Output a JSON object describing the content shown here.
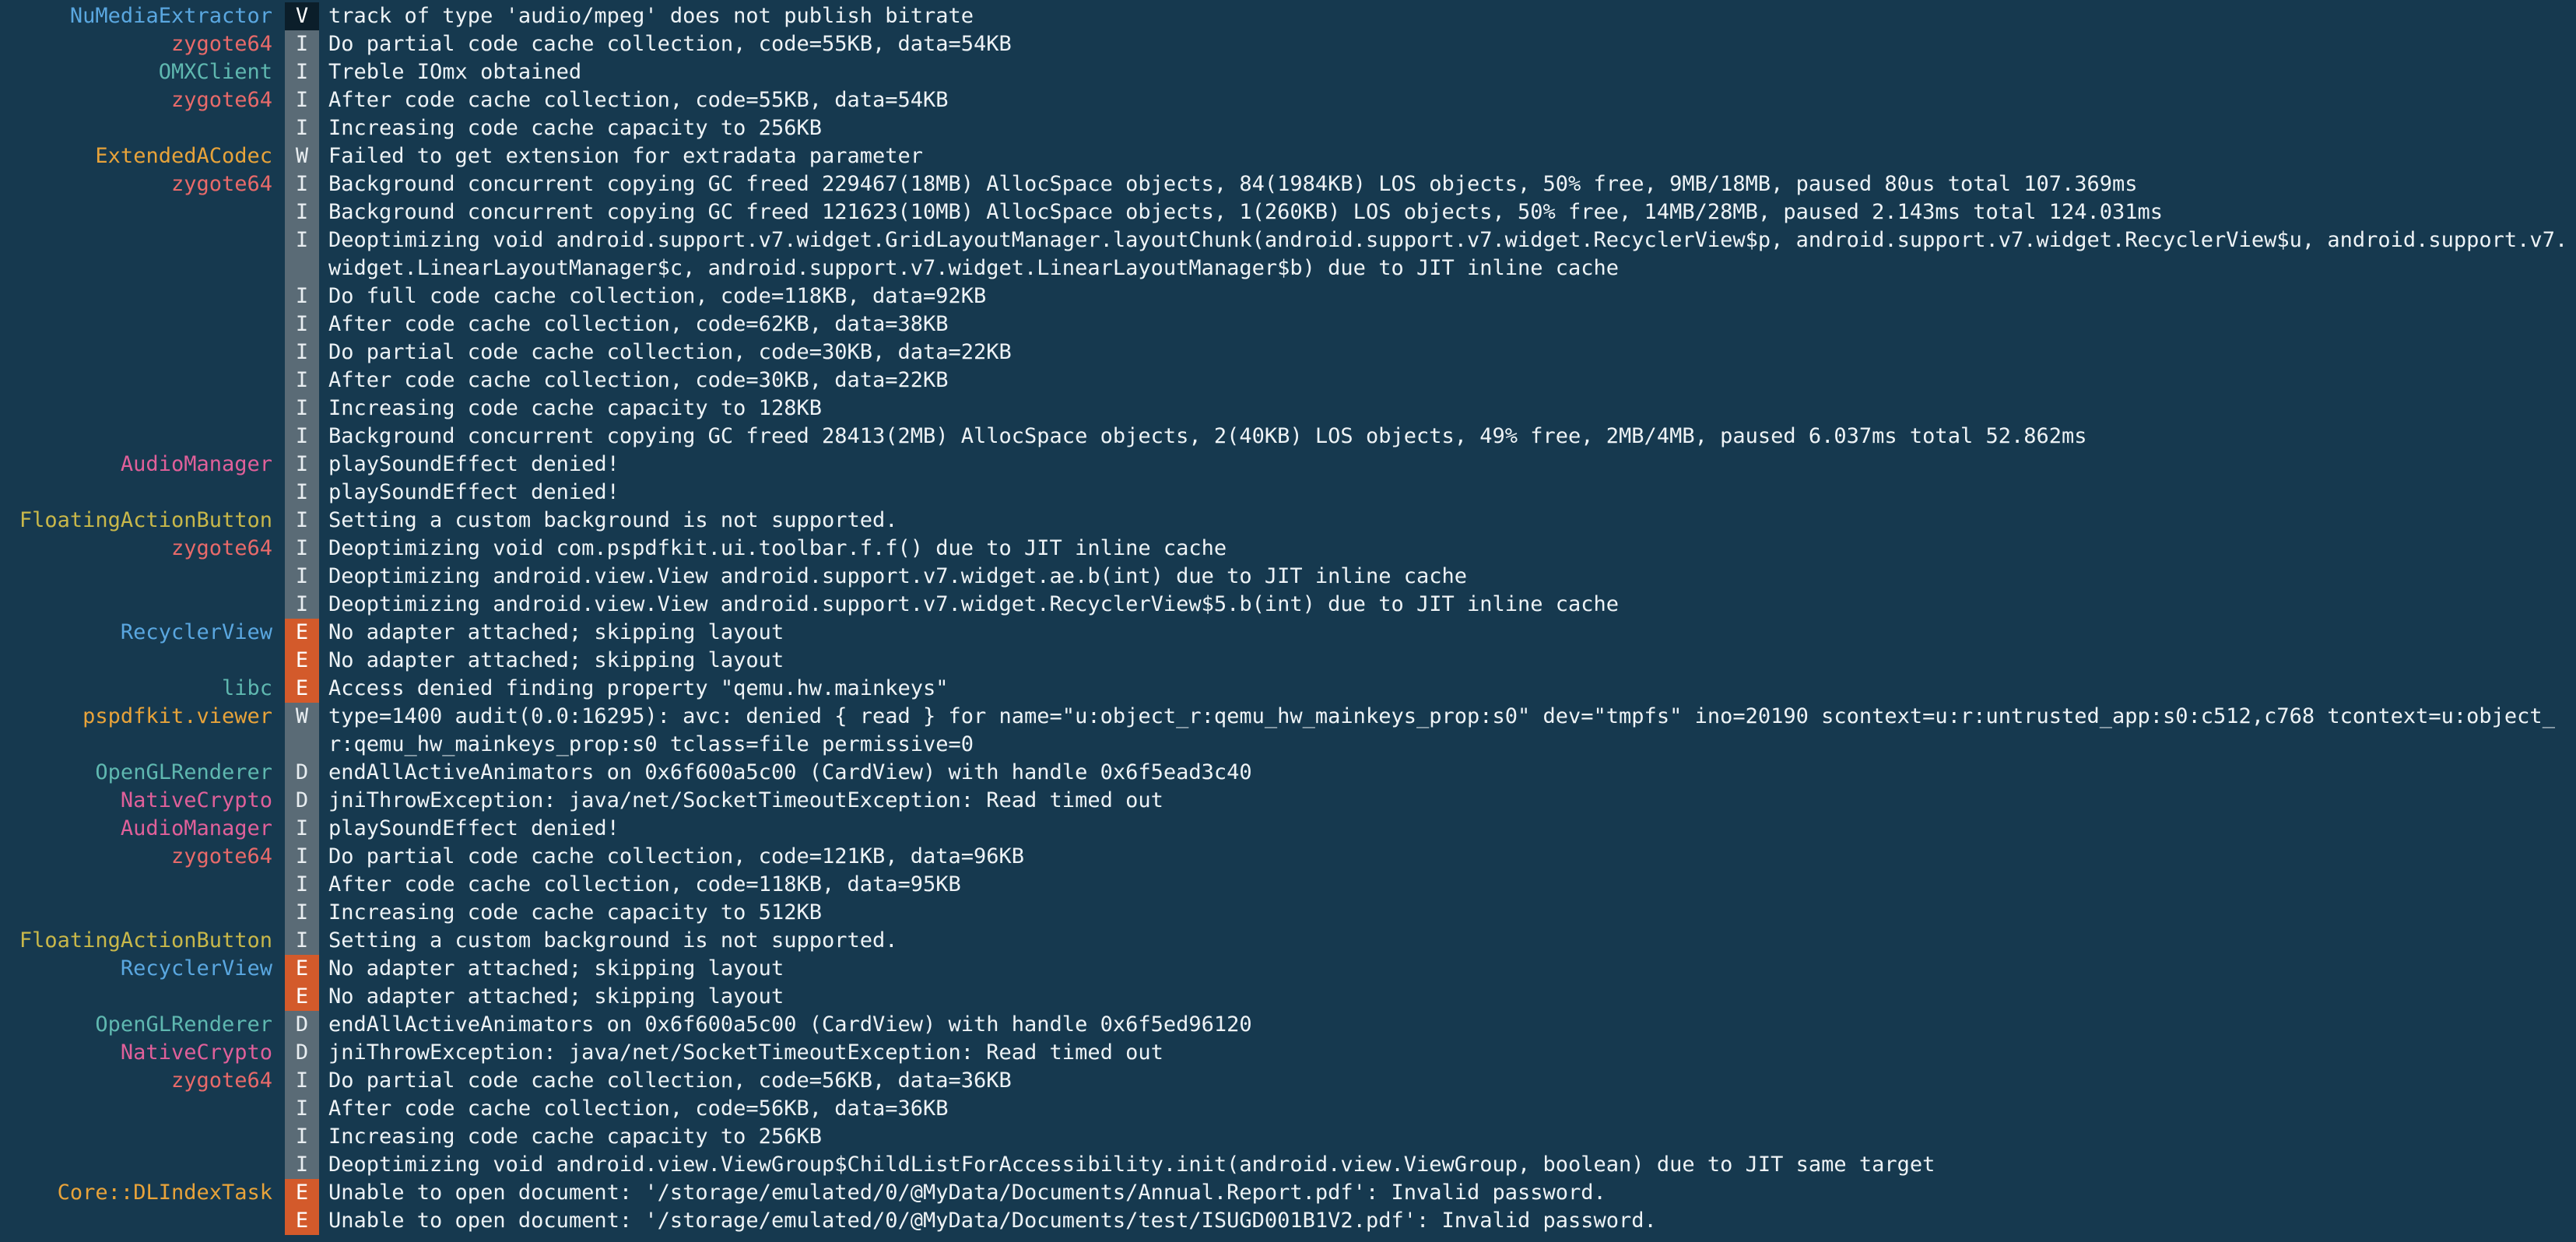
{
  "colors": {
    "background": "#16394f",
    "level_E": "#d35a2b",
    "level_default": "#5a6b76",
    "level_V": "#0b1e2a"
  },
  "tag_colors": {
    "NuMediaExtractor": "#5aa7e0",
    "zygote64": "#e86a6a",
    "OMXClient": "#5fb8b0",
    "ExtendedACodec": "#e8a33a",
    "AudioManager": "#e0609a",
    "FloatingActionButton": "#c9b84a",
    "RecyclerView": "#5aa7e0",
    "libc": "#5fb8b0",
    "pspdfkit.viewer": "#e8a33a",
    "OpenGLRenderer": "#5fb8b0",
    "NativeCrypto": "#e0609a",
    "Core::DLIndexTask": "#e8a33a"
  },
  "rows": [
    {
      "tag": "NuMediaExtractor",
      "level": "V",
      "message": "track of type 'audio/mpeg' does not publish bitrate"
    },
    {
      "tag": "zygote64",
      "level": "I",
      "message": "Do partial code cache collection, code=55KB, data=54KB"
    },
    {
      "tag": "OMXClient",
      "level": "I",
      "message": "Treble IOmx obtained"
    },
    {
      "tag": "zygote64",
      "level": "I",
      "message": "After code cache collection, code=55KB, data=54KB"
    },
    {
      "tag": "",
      "level": "I",
      "message": "Increasing code cache capacity to 256KB"
    },
    {
      "tag": "ExtendedACodec",
      "level": "W",
      "message": "Failed to get extension for extradata parameter"
    },
    {
      "tag": "zygote64",
      "level": "I",
      "message": "Background concurrent copying GC freed 229467(18MB) AllocSpace objects, 84(1984KB) LOS objects, 50% free, 9MB/18MB, paused 80us total 107.369ms"
    },
    {
      "tag": "",
      "level": "I",
      "message": "Background concurrent copying GC freed 121623(10MB) AllocSpace objects, 1(260KB) LOS objects, 50% free, 14MB/28MB, paused 2.143ms total 124.031ms"
    },
    {
      "tag": "",
      "level": "I",
      "message": "Deoptimizing void android.support.v7.widget.GridLayoutManager.layoutChunk(android.support.v7.widget.RecyclerView$p, android.support.v7.widget.RecyclerView$u, android.support.v7.widget.LinearLayoutManager$c, android.support.v7.widget.LinearLayoutManager$b) due to JIT inline cache"
    },
    {
      "tag": "",
      "level": "I",
      "message": "Do full code cache collection, code=118KB, data=92KB"
    },
    {
      "tag": "",
      "level": "I",
      "message": "After code cache collection, code=62KB, data=38KB"
    },
    {
      "tag": "",
      "level": "I",
      "message": "Do partial code cache collection, code=30KB, data=22KB"
    },
    {
      "tag": "",
      "level": "I",
      "message": "After code cache collection, code=30KB, data=22KB"
    },
    {
      "tag": "",
      "level": "I",
      "message": "Increasing code cache capacity to 128KB"
    },
    {
      "tag": "",
      "level": "I",
      "message": "Background concurrent copying GC freed 28413(2MB) AllocSpace objects, 2(40KB) LOS objects, 49% free, 2MB/4MB, paused 6.037ms total 52.862ms"
    },
    {
      "tag": "AudioManager",
      "level": "I",
      "message": "playSoundEffect denied!"
    },
    {
      "tag": "",
      "level": "I",
      "message": "playSoundEffect denied!"
    },
    {
      "tag": "FloatingActionButton",
      "level": "I",
      "message": "Setting a custom background is not supported."
    },
    {
      "tag": "zygote64",
      "level": "I",
      "message": "Deoptimizing void com.pspdfkit.ui.toolbar.f.f() due to JIT inline cache"
    },
    {
      "tag": "",
      "level": "I",
      "message": "Deoptimizing android.view.View android.support.v7.widget.ae.b(int) due to JIT inline cache"
    },
    {
      "tag": "",
      "level": "I",
      "message": "Deoptimizing android.view.View android.support.v7.widget.RecyclerView$5.b(int) due to JIT inline cache"
    },
    {
      "tag": "RecyclerView",
      "level": "E",
      "message": "No adapter attached; skipping layout"
    },
    {
      "tag": "",
      "level": "E",
      "message": "No adapter attached; skipping layout"
    },
    {
      "tag": "libc",
      "level": "E",
      "message": "Access denied finding property \"qemu.hw.mainkeys\""
    },
    {
      "tag": "pspdfkit.viewer",
      "level": "W",
      "message": "type=1400 audit(0.0:16295): avc: denied { read } for name=\"u:object_r:qemu_hw_mainkeys_prop:s0\" dev=\"tmpfs\" ino=20190 scontext=u:r:untrusted_app:s0:c512,c768 tcontext=u:object_r:qemu_hw_mainkeys_prop:s0 tclass=file permissive=0"
    },
    {
      "tag": "OpenGLRenderer",
      "level": "D",
      "message": "endAllActiveAnimators on 0x6f600a5c00 (CardView) with handle 0x6f5ead3c40"
    },
    {
      "tag": "NativeCrypto",
      "level": "D",
      "message": "jniThrowException: java/net/SocketTimeoutException: Read timed out"
    },
    {
      "tag": "AudioManager",
      "level": "I",
      "message": "playSoundEffect denied!"
    },
    {
      "tag": "zygote64",
      "level": "I",
      "message": "Do partial code cache collection, code=121KB, data=96KB"
    },
    {
      "tag": "",
      "level": "I",
      "message": "After code cache collection, code=118KB, data=95KB"
    },
    {
      "tag": "",
      "level": "I",
      "message": "Increasing code cache capacity to 512KB"
    },
    {
      "tag": "FloatingActionButton",
      "level": "I",
      "message": "Setting a custom background is not supported."
    },
    {
      "tag": "RecyclerView",
      "level": "E",
      "message": "No adapter attached; skipping layout"
    },
    {
      "tag": "",
      "level": "E",
      "message": "No adapter attached; skipping layout"
    },
    {
      "tag": "OpenGLRenderer",
      "level": "D",
      "message": "endAllActiveAnimators on 0x6f600a5c00 (CardView) with handle 0x6f5ed96120"
    },
    {
      "tag": "NativeCrypto",
      "level": "D",
      "message": "jniThrowException: java/net/SocketTimeoutException: Read timed out"
    },
    {
      "tag": "zygote64",
      "level": "I",
      "message": "Do partial code cache collection, code=56KB, data=36KB"
    },
    {
      "tag": "",
      "level": "I",
      "message": "After code cache collection, code=56KB, data=36KB"
    },
    {
      "tag": "",
      "level": "I",
      "message": "Increasing code cache capacity to 256KB"
    },
    {
      "tag": "",
      "level": "I",
      "message": "Deoptimizing void android.view.ViewGroup$ChildListForAccessibility.init(android.view.ViewGroup, boolean) due to JIT same target"
    },
    {
      "tag": "Core::DLIndexTask",
      "level": "E",
      "message": "Unable to open document: '/storage/emulated/0/@MyData/Documents/Annual.Report.pdf': Invalid password."
    },
    {
      "tag": "",
      "level": "E",
      "message": "Unable to open document: '/storage/emulated/0/@MyData/Documents/test/ISUGD001B1V2.pdf': Invalid password."
    }
  ]
}
